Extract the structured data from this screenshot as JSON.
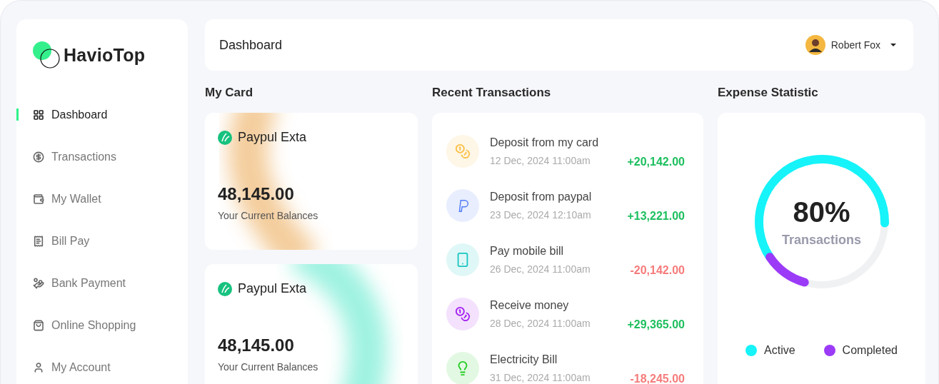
{
  "brand": {
    "name": "HavioTop"
  },
  "sidebar": {
    "items": [
      {
        "label": "Dashboard",
        "selected": true
      },
      {
        "label": "Transactions",
        "selected": false
      },
      {
        "label": "My Wallet",
        "selected": false
      },
      {
        "label": "Bill Pay",
        "selected": false
      },
      {
        "label": "Bank Payment",
        "selected": false
      },
      {
        "label": "Online Shopping",
        "selected": false
      },
      {
        "label": "My Account",
        "selected": false
      }
    ]
  },
  "header": {
    "title": "Dashboard",
    "user": {
      "name": "Robert Fox"
    }
  },
  "my_card": {
    "heading": "My Card",
    "cards": [
      {
        "name": "Paypul Exta",
        "balance": "48,145.00",
        "caption": "Your Current Balances",
        "kind": "warm"
      },
      {
        "name": "Paypul Exta",
        "balance": "48,145.00",
        "caption": "Your Current Balances",
        "kind": "mint"
      }
    ]
  },
  "recent_transactions": {
    "heading": "Recent Transactions",
    "items": [
      {
        "title": "Deposit from my card",
        "date": "12 Dec, 2024 11:00am",
        "amount": "+20,142.00",
        "kind": "credit",
        "color": "#fbbf45"
      },
      {
        "title": "Deposit from paypal",
        "date": "23 Dec, 2024 12:10am",
        "amount": "+13,221.00",
        "kind": "credit",
        "color": "#4f7cf7"
      },
      {
        "title": "Pay mobile bill",
        "date": "26 Dec, 2024 11:00am",
        "amount": "-20,142.00",
        "kind": "debit",
        "color": "#19c6c2"
      },
      {
        "title": "Receive money",
        "date": "28 Dec, 2024 11:00am",
        "amount": "+29,365.00",
        "kind": "credit",
        "color": "#a21cf0"
      },
      {
        "title": "Electricity Bill",
        "date": "31 Dec, 2024 11:00am",
        "amount": "-18,245.00",
        "kind": "debit",
        "color": "#22cc22"
      }
    ]
  },
  "expense_statistic": {
    "heading": "Expense Statistic",
    "percent": "80%",
    "caption": "Transactions",
    "legend": [
      {
        "label": "Active",
        "color": "#16f3f9"
      },
      {
        "label": "Completed",
        "color": "#9b3bf7"
      }
    ]
  }
}
